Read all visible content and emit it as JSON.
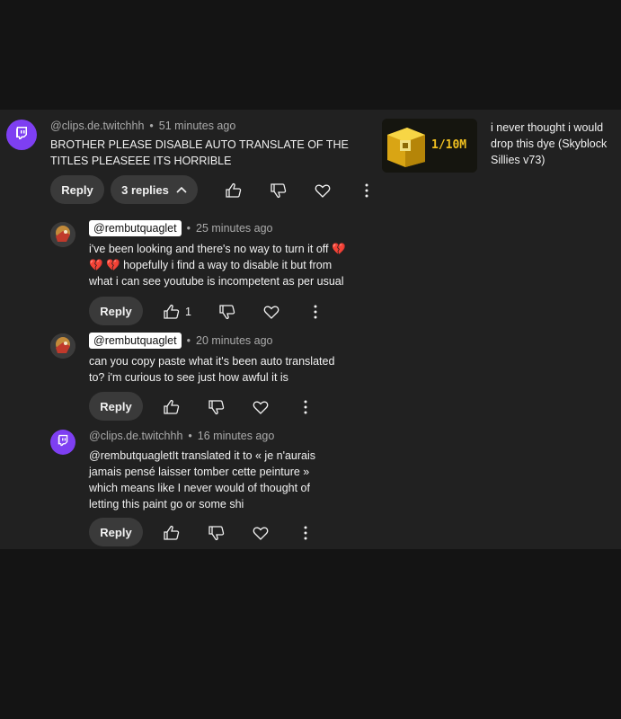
{
  "comments": [
    {
      "author": "@clips.de.twitchhh",
      "time": "51 minutes ago",
      "text": "BROTHER PLEASE DISABLE AUTO TRANSLATE OF THE TITLES PLEASEEE ITS HORRIBLE",
      "reply_label": "Reply",
      "replies_label": "3 replies"
    }
  ],
  "replies": [
    {
      "author": "@rembutquaglet",
      "time": "25 minutes ago",
      "line1": "i've been looking and there's no way to turn it off 💔",
      "line2": "💔 💔 hopefully i find a way to disable it but from",
      "line3": "what i can see youtube is incompetent as per usual",
      "reply_label": "Reply",
      "likes": "1"
    },
    {
      "author": "@rembutquaglet",
      "time": "20 minutes ago",
      "line1": "can you copy paste what it's been auto translated",
      "line2": "to? i'm curious to see just how awful it is",
      "reply_label": "Reply"
    },
    {
      "author": "@clips.de.twitchhh",
      "time": "16 minutes ago",
      "line1": "@rembutquagletIt translated it to « je n'aurais",
      "line2": "jamais pensé laisser tomber cette peinture »",
      "line3": "which means like I never would of thought of",
      "line4": "letting this paint go or some shi",
      "reply_label": "Reply"
    }
  ],
  "sidebar_video": {
    "thumbnail_text": "1/10M",
    "title": "i never thought i would drop this dye (Skyblock Sillies v73)"
  },
  "icons": {
    "like": "thumbs-up-icon",
    "dislike": "thumbs-down-icon",
    "heart": "heart-icon",
    "more": "more-vert-icon",
    "chevron": "chevron-up-icon",
    "twitch": "twitch-logo-icon"
  },
  "colors": {
    "background": "#141414",
    "panel": "#212121",
    "pill": "#3a3a3a",
    "twitch_purple": "#7e3ff2",
    "text": "#f1f1f1",
    "meta": "#aaaaaa"
  }
}
